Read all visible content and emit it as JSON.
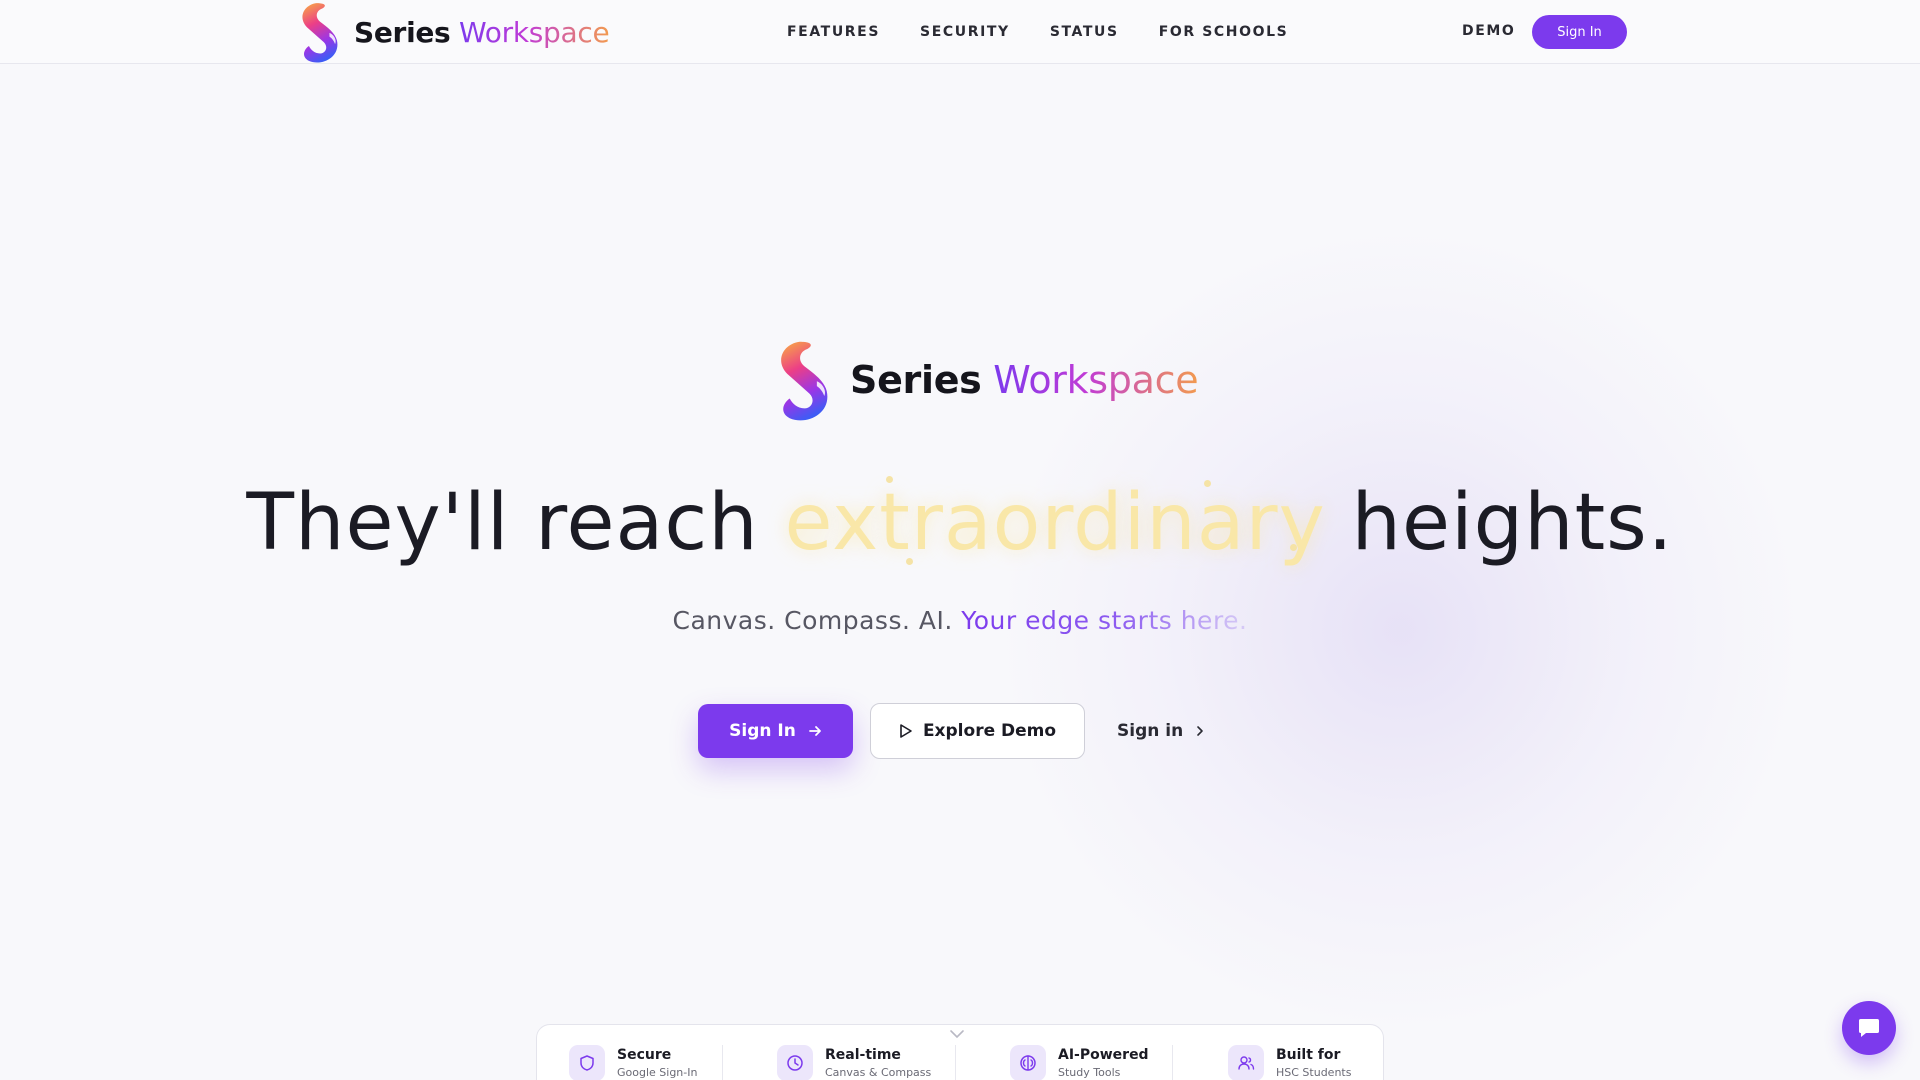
{
  "brand": {
    "name_bold": "Series",
    "name_gradient": "Workspace"
  },
  "nav": {
    "items": [
      "FEATURES",
      "SECURITY",
      "STATUS",
      "FOR SCHOOLS"
    ],
    "demo": "DEMO",
    "sign_in": "Sign In"
  },
  "hero": {
    "headline_start": "They'll reach",
    "headline_accent": "extraordinary",
    "headline_end": "heights.",
    "sub_plain": "Canvas. Compass. AI.",
    "sub_accent": "Your edge starts here."
  },
  "cta": {
    "primary": "Sign In",
    "demo": "Explore Demo",
    "secondary": "Sign in"
  },
  "features": [
    {
      "title": "Secure",
      "subtitle": "Google Sign-In",
      "icon": "shield-icon"
    },
    {
      "title": "Real-time",
      "subtitle": "Canvas & Compass",
      "icon": "clock-icon"
    },
    {
      "title": "AI-Powered",
      "subtitle": "Study Tools",
      "icon": "brain-icon"
    },
    {
      "title": "Built for",
      "subtitle": "HSC Students",
      "icon": "users-icon"
    }
  ],
  "colors": {
    "accent": "#7c3aed",
    "background": "#f8f8fb",
    "highlight": "#f9e7a8"
  },
  "icons": {
    "chat": "chat-icon",
    "play": "play-icon",
    "arrow": "arrow-right-icon",
    "chevron": "chevron-right-icon"
  }
}
